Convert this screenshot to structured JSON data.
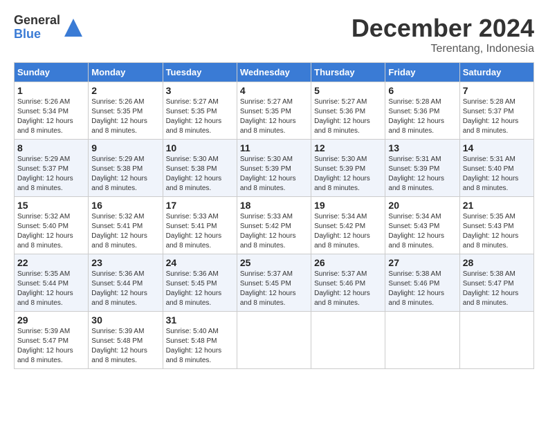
{
  "logo": {
    "general": "General",
    "blue": "Blue"
  },
  "title": "December 2024",
  "location": "Terentang, Indonesia",
  "days_of_week": [
    "Sunday",
    "Monday",
    "Tuesday",
    "Wednesday",
    "Thursday",
    "Friday",
    "Saturday"
  ],
  "weeks": [
    [
      {
        "day": "1",
        "sunrise": "5:26 AM",
        "sunset": "5:34 PM",
        "daylight": "12 hours and 8 minutes."
      },
      {
        "day": "2",
        "sunrise": "5:26 AM",
        "sunset": "5:35 PM",
        "daylight": "12 hours and 8 minutes."
      },
      {
        "day": "3",
        "sunrise": "5:27 AM",
        "sunset": "5:35 PM",
        "daylight": "12 hours and 8 minutes."
      },
      {
        "day": "4",
        "sunrise": "5:27 AM",
        "sunset": "5:35 PM",
        "daylight": "12 hours and 8 minutes."
      },
      {
        "day": "5",
        "sunrise": "5:27 AM",
        "sunset": "5:36 PM",
        "daylight": "12 hours and 8 minutes."
      },
      {
        "day": "6",
        "sunrise": "5:28 AM",
        "sunset": "5:36 PM",
        "daylight": "12 hours and 8 minutes."
      },
      {
        "day": "7",
        "sunrise": "5:28 AM",
        "sunset": "5:37 PM",
        "daylight": "12 hours and 8 minutes."
      }
    ],
    [
      {
        "day": "8",
        "sunrise": "5:29 AM",
        "sunset": "5:37 PM",
        "daylight": "12 hours and 8 minutes."
      },
      {
        "day": "9",
        "sunrise": "5:29 AM",
        "sunset": "5:38 PM",
        "daylight": "12 hours and 8 minutes."
      },
      {
        "day": "10",
        "sunrise": "5:30 AM",
        "sunset": "5:38 PM",
        "daylight": "12 hours and 8 minutes."
      },
      {
        "day": "11",
        "sunrise": "5:30 AM",
        "sunset": "5:39 PM",
        "daylight": "12 hours and 8 minutes."
      },
      {
        "day": "12",
        "sunrise": "5:30 AM",
        "sunset": "5:39 PM",
        "daylight": "12 hours and 8 minutes."
      },
      {
        "day": "13",
        "sunrise": "5:31 AM",
        "sunset": "5:39 PM",
        "daylight": "12 hours and 8 minutes."
      },
      {
        "day": "14",
        "sunrise": "5:31 AM",
        "sunset": "5:40 PM",
        "daylight": "12 hours and 8 minutes."
      }
    ],
    [
      {
        "day": "15",
        "sunrise": "5:32 AM",
        "sunset": "5:40 PM",
        "daylight": "12 hours and 8 minutes."
      },
      {
        "day": "16",
        "sunrise": "5:32 AM",
        "sunset": "5:41 PM",
        "daylight": "12 hours and 8 minutes."
      },
      {
        "day": "17",
        "sunrise": "5:33 AM",
        "sunset": "5:41 PM",
        "daylight": "12 hours and 8 minutes."
      },
      {
        "day": "18",
        "sunrise": "5:33 AM",
        "sunset": "5:42 PM",
        "daylight": "12 hours and 8 minutes."
      },
      {
        "day": "19",
        "sunrise": "5:34 AM",
        "sunset": "5:42 PM",
        "daylight": "12 hours and 8 minutes."
      },
      {
        "day": "20",
        "sunrise": "5:34 AM",
        "sunset": "5:43 PM",
        "daylight": "12 hours and 8 minutes."
      },
      {
        "day": "21",
        "sunrise": "5:35 AM",
        "sunset": "5:43 PM",
        "daylight": "12 hours and 8 minutes."
      }
    ],
    [
      {
        "day": "22",
        "sunrise": "5:35 AM",
        "sunset": "5:44 PM",
        "daylight": "12 hours and 8 minutes."
      },
      {
        "day": "23",
        "sunrise": "5:36 AM",
        "sunset": "5:44 PM",
        "daylight": "12 hours and 8 minutes."
      },
      {
        "day": "24",
        "sunrise": "5:36 AM",
        "sunset": "5:45 PM",
        "daylight": "12 hours and 8 minutes."
      },
      {
        "day": "25",
        "sunrise": "5:37 AM",
        "sunset": "5:45 PM",
        "daylight": "12 hours and 8 minutes."
      },
      {
        "day": "26",
        "sunrise": "5:37 AM",
        "sunset": "5:46 PM",
        "daylight": "12 hours and 8 minutes."
      },
      {
        "day": "27",
        "sunrise": "5:38 AM",
        "sunset": "5:46 PM",
        "daylight": "12 hours and 8 minutes."
      },
      {
        "day": "28",
        "sunrise": "5:38 AM",
        "sunset": "5:47 PM",
        "daylight": "12 hours and 8 minutes."
      }
    ],
    [
      {
        "day": "29",
        "sunrise": "5:39 AM",
        "sunset": "5:47 PM",
        "daylight": "12 hours and 8 minutes."
      },
      {
        "day": "30",
        "sunrise": "5:39 AM",
        "sunset": "5:48 PM",
        "daylight": "12 hours and 8 minutes."
      },
      {
        "day": "31",
        "sunrise": "5:40 AM",
        "sunset": "5:48 PM",
        "daylight": "12 hours and 8 minutes."
      },
      null,
      null,
      null,
      null
    ]
  ],
  "labels": {
    "sunrise": "Sunrise:",
    "sunset": "Sunset:",
    "daylight": "Daylight:"
  }
}
